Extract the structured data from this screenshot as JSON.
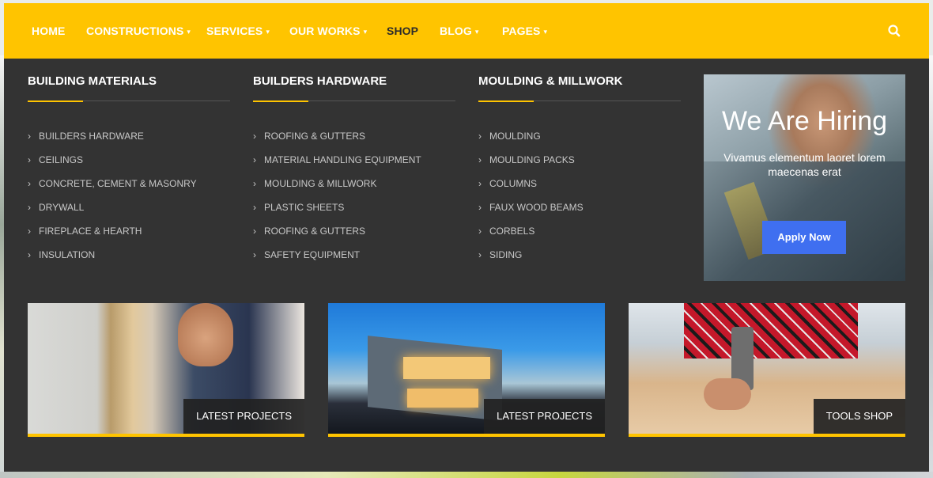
{
  "nav": {
    "items": [
      {
        "label": "HOME",
        "caret": false
      },
      {
        "label": "CONSTRUCTIONS",
        "caret": true
      },
      {
        "label": "SERVICES",
        "caret": true
      },
      {
        "label": "OUR WORKS",
        "caret": true
      },
      {
        "label": "SHOP",
        "caret": false,
        "active": true
      },
      {
        "label": "BLOG",
        "caret": true
      },
      {
        "label": "PAGES",
        "caret": true
      }
    ],
    "caret_glyph": "▾",
    "search_icon": "search-icon"
  },
  "colors": {
    "accent": "#ffc400",
    "menu_bg": "#333333",
    "button": "#3f6ff0"
  },
  "mega": {
    "columns": [
      {
        "title": "BUILDING MATERIALS",
        "items": [
          "BUILDERS HARDWARE",
          "CEILINGS",
          "CONCRETE, CEMENT & MASONRY",
          "DRYWALL",
          "FIREPLACE & HEARTH",
          "INSULATION"
        ]
      },
      {
        "title": "BUILDERS HARDWARE",
        "items": [
          "ROOFING & GUTTERS",
          "MATERIAL HANDLING EQUIPMENT",
          "MOULDING & MILLWORK",
          "PLASTIC SHEETS",
          "ROOFING & GUTTERS",
          "SAFETY EQUIPMENT"
        ]
      },
      {
        "title": "MOULDING & MILLWORK",
        "items": [
          "MOULDING",
          "MOULDING PACKS",
          "COLUMNS",
          "FAUX WOOD BEAMS",
          "CORBELS",
          "SIDING"
        ]
      }
    ],
    "chevron": "›",
    "hiring": {
      "title": "We Are Hiring",
      "subtitle": "Vivamus elementum laoret lorem maecenas erat",
      "button": "Apply Now"
    },
    "tiles": [
      {
        "label": "LATEST PROJECTS"
      },
      {
        "label": "LATEST PROJECTS"
      },
      {
        "label": "TOOLS SHOP"
      }
    ]
  }
}
